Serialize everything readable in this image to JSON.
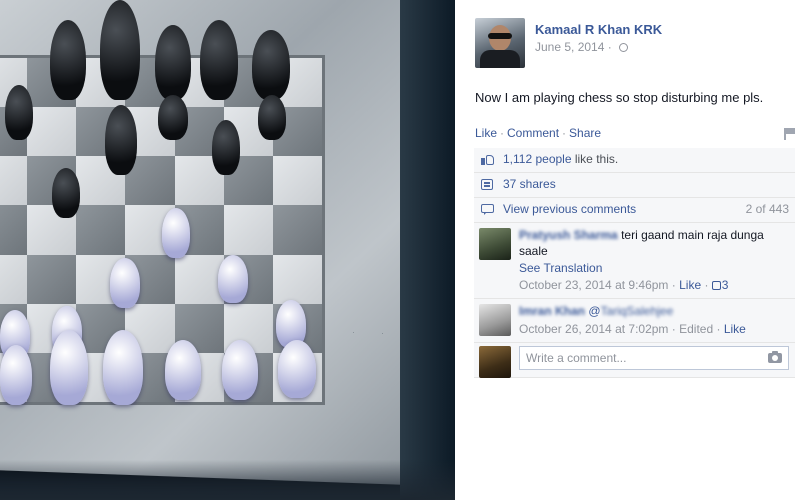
{
  "post": {
    "author": "Kamaal R Khan KRK",
    "date": "June 5, 2014",
    "text": "Now I am playing chess so stop disturbing me pls.",
    "actions": {
      "like": "Like",
      "comment": "Comment",
      "share": "Share",
      "sep": "·"
    },
    "likes_count": "1,112 people",
    "likes_suffix": " like this.",
    "shares": "37 shares",
    "view_previous": "View previous comments",
    "comments_count": "2 of 443",
    "write_placeholder": "Write a comment...",
    "icons": [
      "privacy-globe-icon",
      "flag-icon",
      "like-icon",
      "share-icon",
      "comment-icon",
      "camera-icon"
    ]
  },
  "comments": [
    {
      "name": "Pratyush Sharma",
      "text": "teri gaand main raja dunga saale",
      "translate": "See Translation",
      "date": "October 23, 2014 at 9:46pm",
      "like": "Like",
      "likes": "3"
    },
    {
      "name": "Imran Khan",
      "mention_prefix": "@",
      "mention": "TariqSalehjee",
      "date": "October 26, 2014 at 7:02pm",
      "edited": "Edited",
      "like": "Like"
    }
  ],
  "colors": {
    "link": "#3b5998",
    "meta": "#90949c",
    "ufi_bg": "#f6f7f9"
  }
}
